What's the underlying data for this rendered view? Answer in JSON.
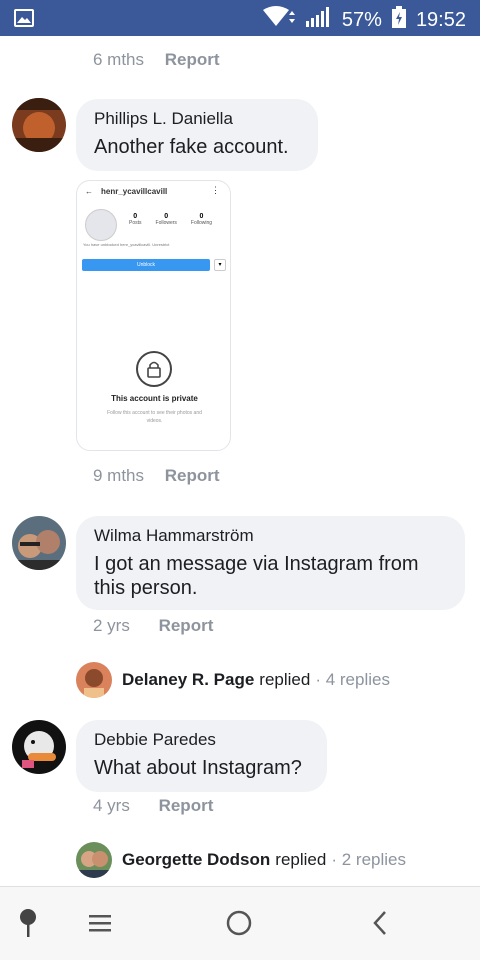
{
  "status_bar": {
    "battery": "57%",
    "time": "19:52",
    "icons": [
      "image-icon",
      "wifi-icon",
      "signal-icon",
      "battery-charging-icon"
    ]
  },
  "comments": [
    {
      "time": "6 mths",
      "report": "Report"
    },
    {
      "name": "Phillips L. Daniella",
      "text": "Another fake account.",
      "time": "9 mths",
      "report": "Report"
    },
    {
      "name": "Wilma Hammarström",
      "text": "I got an message via Instagram from this person.",
      "time": "2 yrs",
      "report": "Report"
    },
    {
      "name": "Debbie Paredes",
      "text": "What about Instagram?",
      "time": "4 yrs",
      "report": "Report"
    }
  ],
  "reply_threads": [
    {
      "name": "Delaney R. Page",
      "action": "replied",
      "count": "· 4 replies"
    },
    {
      "name": "Georgette Dodson",
      "action": "replied",
      "count": "· 2 replies"
    }
  ],
  "attachment": {
    "username": "henr_ycavillcavill",
    "stats": [
      {
        "value": "0",
        "label": "Posts"
      },
      {
        "value": "0",
        "label": "Followers"
      },
      {
        "value": "0",
        "label": "Following"
      }
    ],
    "blocked_note": "You have unblocked henr_ycavillcavill. Unrestrict",
    "unblock_label": "Unblock",
    "private_title": "This account is private",
    "private_sub": "Follow this account to see their photos and videos."
  },
  "navbar": {
    "icons": [
      "pin-icon",
      "menu-icon",
      "home-circle-icon",
      "back-icon"
    ]
  }
}
